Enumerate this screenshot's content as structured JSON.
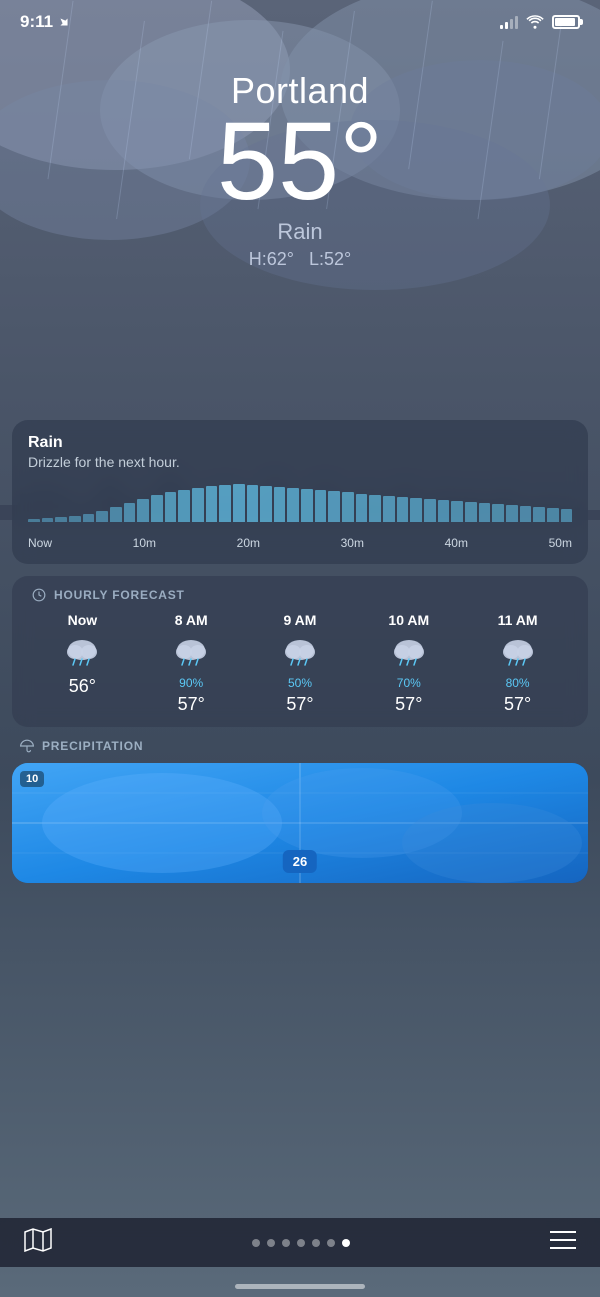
{
  "status_bar": {
    "time": "9:11",
    "location_icon": "location-arrow"
  },
  "weather": {
    "city": "Portland",
    "temperature": "55°",
    "condition": "Rain",
    "high": "H:62°",
    "low": "L:52°",
    "rain_title": "Rain",
    "rain_subtitle": "Drizzle for the next hour.",
    "chart_labels": [
      "Now",
      "10m",
      "20m",
      "30m",
      "40m",
      "50m"
    ]
  },
  "hourly_forecast": {
    "section_label": "HOURLY FORECAST",
    "items": [
      {
        "time": "Now",
        "precip": "",
        "temp": "56°"
      },
      {
        "time": "8 AM",
        "precip": "90%",
        "temp": "57°"
      },
      {
        "time": "9 AM",
        "precip": "50%",
        "temp": "57°"
      },
      {
        "time": "10 AM",
        "precip": "70%",
        "temp": "57°"
      },
      {
        "time": "11 AM",
        "precip": "80%",
        "temp": "57°"
      }
    ]
  },
  "precipitation": {
    "section_label": "PRECIPITATION",
    "map_badge": "10",
    "route_badge": "26"
  },
  "tab_bar": {
    "dots_count": 7,
    "active_dot": 6
  },
  "chart_bars": [
    3,
    4,
    5,
    6,
    8,
    10,
    14,
    18,
    22,
    26,
    28,
    30,
    32,
    34,
    35,
    36,
    35,
    34,
    33,
    32,
    31,
    30,
    29,
    28,
    27,
    26,
    25,
    24,
    23,
    22,
    21,
    20,
    19,
    18,
    17,
    16,
    15,
    14,
    13,
    12
  ]
}
